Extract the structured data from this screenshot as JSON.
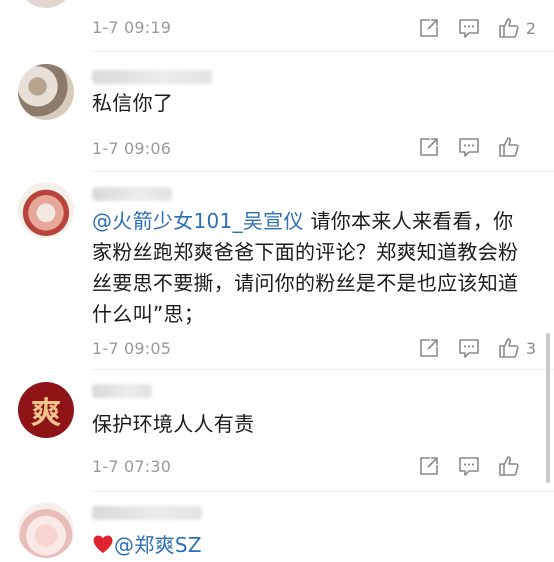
{
  "comments": [
    {
      "time": "1-7 09:19",
      "likes": "2",
      "text_plain": "",
      "mention": "",
      "text_rest": ""
    },
    {
      "time": "1-7 09:06",
      "likes": "",
      "text_plain": "私信你了",
      "mention": "",
      "text_rest": ""
    },
    {
      "time": "1-7 09:05",
      "likes": "3",
      "text_plain": "",
      "mention": "@火箭少女101_吴宣仪",
      "text_rest": " 请你本来人来看看，你家粉丝跑郑爽爸爸下面的评论？郑爽知道教会粉丝要思不要撕，请问你的粉丝是不是也应该知道什么叫”思；"
    },
    {
      "time": "1-7 07:30",
      "likes": "",
      "text_plain": "保护环境人人有责",
      "mention": "",
      "text_rest": ""
    },
    {
      "time": "",
      "likes": "",
      "text_plain": "",
      "mention": "@郑爽SZ",
      "text_rest": ""
    }
  ],
  "avatar_badge_char": "爽",
  "icons": {
    "share": "share-icon",
    "comment": "comment-icon",
    "like": "thumbs-up-icon",
    "heart": "heart-icon"
  },
  "colors": {
    "mention": "#2d6fb7",
    "time": "#9a9a9a",
    "heart": "#e0242f",
    "avatar_badge_bg": "#8e1418"
  }
}
